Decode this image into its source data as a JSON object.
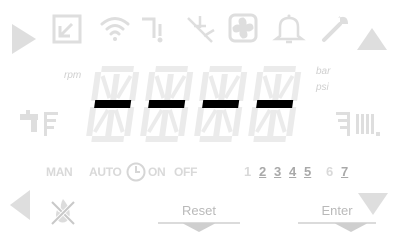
{
  "top_icons": [
    {
      "name": "play-icon",
      "state": "dim"
    },
    {
      "name": "external-link-icon",
      "state": "dim"
    },
    {
      "name": "wifi-icon",
      "state": "dim"
    },
    {
      "name": "water-tap-drop-icon",
      "state": "dim"
    },
    {
      "name": "defrost-icon",
      "state": "dim"
    },
    {
      "name": "fan-icon",
      "state": "dim"
    },
    {
      "name": "bell-icon",
      "state": "dim"
    },
    {
      "name": "wrench-icon",
      "state": "dim"
    },
    {
      "name": "arrow-up-icon",
      "state": "dim"
    }
  ],
  "display": {
    "left_unit": "rpm",
    "right_unit_top": "bar",
    "right_unit_bottom": "psi",
    "digits": [
      "-",
      "-",
      "-",
      "-"
    ]
  },
  "side_icons": {
    "left": [
      "faucet-icon",
      "heat-lines-icon"
    ],
    "right": [
      "heat-lines-icon",
      "radiator-icon"
    ]
  },
  "modes": {
    "man": "MAN",
    "auto": "AUTO",
    "clock_icon": "clock-icon",
    "on": "ON",
    "off": "OFF"
  },
  "days": [
    {
      "label": "1",
      "active": false
    },
    {
      "label": "2",
      "active": true
    },
    {
      "label": "3",
      "active": true
    },
    {
      "label": "4",
      "active": true
    },
    {
      "label": "5",
      "active": true
    },
    {
      "label": "6",
      "active": false
    },
    {
      "label": "7",
      "active": true
    }
  ],
  "buttons": {
    "reset": "Reset",
    "enter": "Enter"
  },
  "colors": {
    "dim_icon": "#dedede",
    "segment_off": "#ebebeb",
    "segment_on": "#000000",
    "label_gray": "#b9b9b9"
  }
}
